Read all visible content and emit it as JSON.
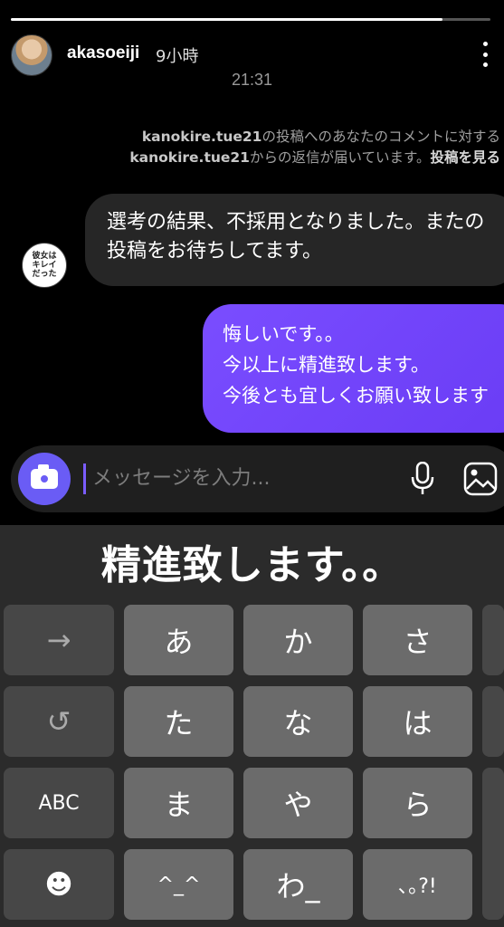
{
  "story": {
    "progress": 0.9
  },
  "header": {
    "username": "akasoeiji",
    "time_ago": "9小時",
    "menu_icon": "more-vertical-icon"
  },
  "timestamp": "21:31",
  "notice": {
    "line1_account": "kanokire.tue21",
    "line1_rest": "の投稿へのあなたのコメントに対する",
    "line2_account": "kanokire.tue21",
    "line2_rest": "からの返信が届いています。",
    "view_post": "投稿を見る"
  },
  "messages": {
    "incoming": "選考の結果、不採用となりました。またの投稿をお待ちしてます。",
    "outgoing_lines": [
      "悔しいです。。",
      "今以上に精進致します。",
      "今後とも宜しくお願い致します"
    ]
  },
  "composer": {
    "placeholder": "メッセージを入力...",
    "camera_icon": "camera-icon",
    "mic_icon": "microphone-icon",
    "gallery_icon": "image-gallery-icon"
  },
  "keyboard": {
    "suggestion": "精進致します。。",
    "keys": {
      "arrow": "→",
      "a": "あ",
      "ka": "か",
      "sa": "さ",
      "undo": "↺",
      "ta": "た",
      "na": "な",
      "ha": "は",
      "abc": "ABC",
      "ma": "ま",
      "ya": "や",
      "ra": "ら",
      "emoji": "☻",
      "kaomoji": "^_^",
      "wa": "わ_",
      "punct": "､｡?!"
    }
  }
}
